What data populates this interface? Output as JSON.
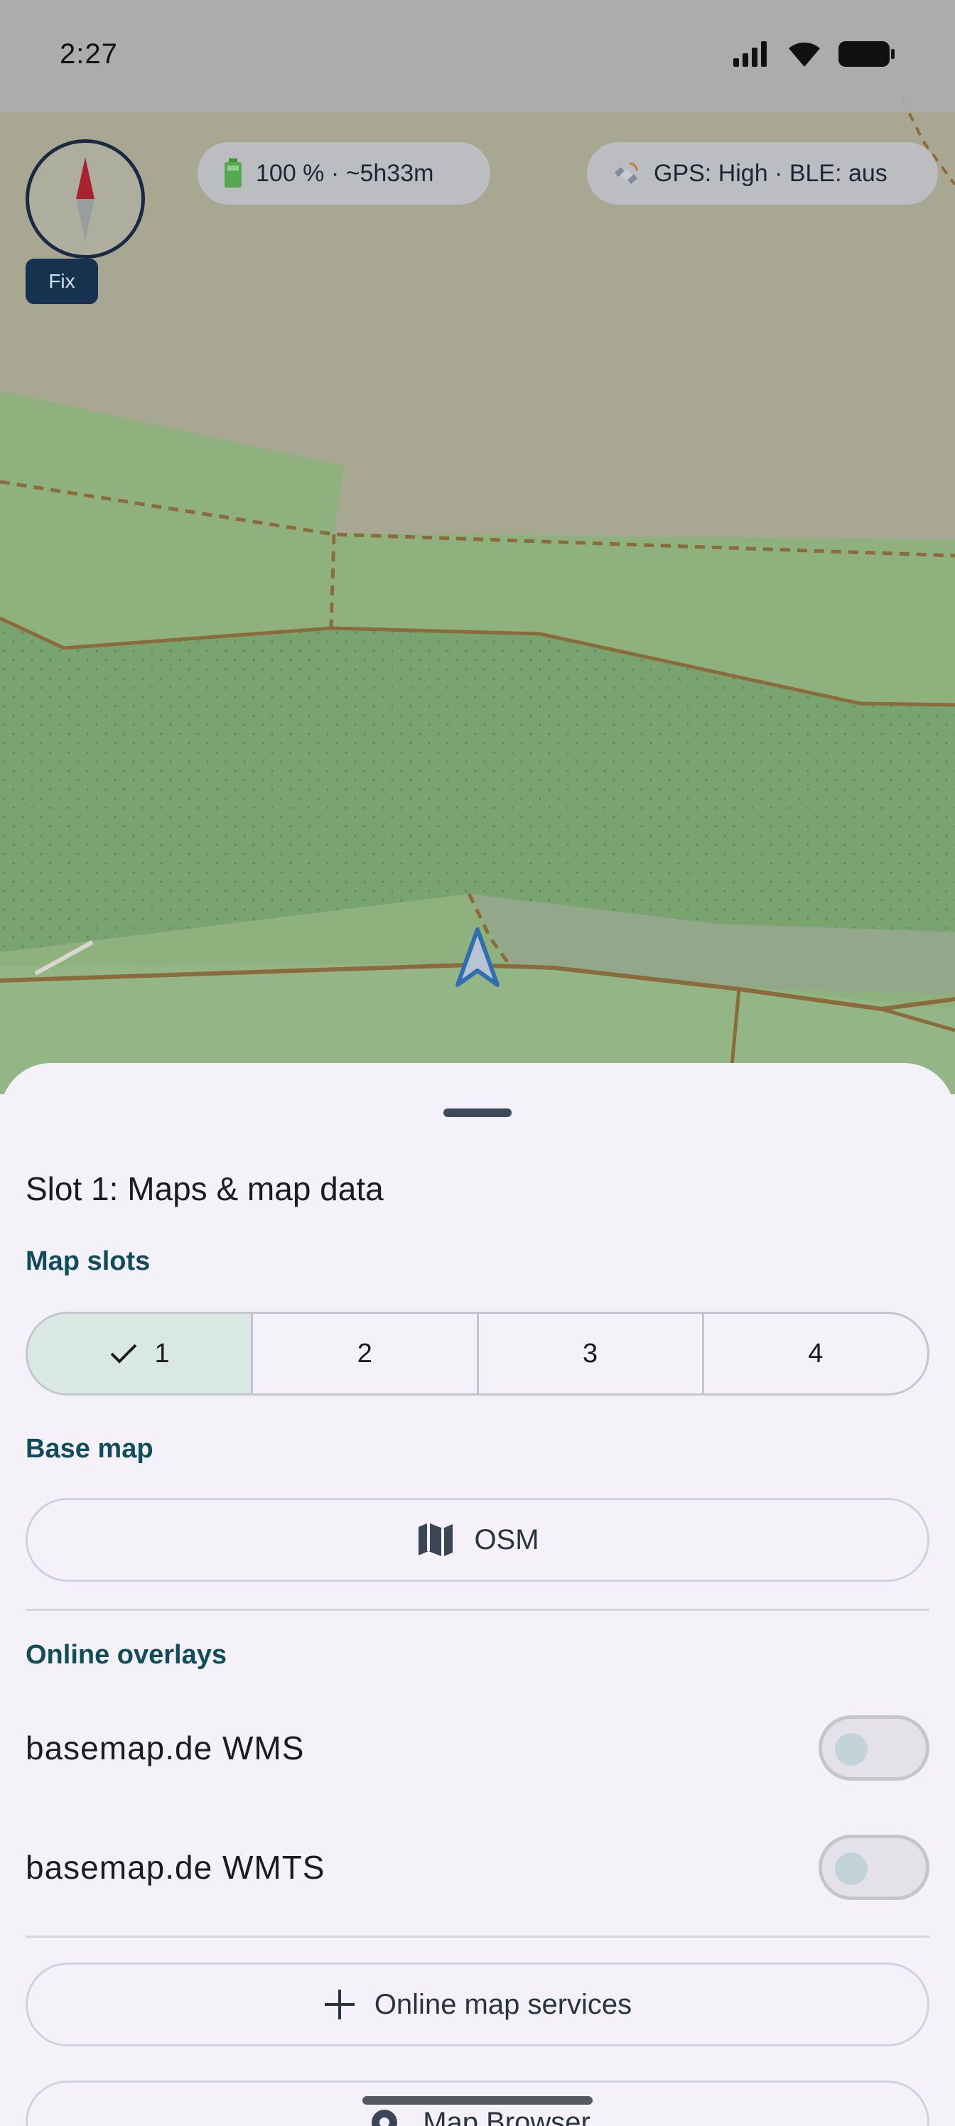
{
  "status_bar": {
    "time": "2:27"
  },
  "map": {
    "battery_text": "100 % · ~5h33m",
    "gps_text": "GPS: High · BLE: aus",
    "fix_label": "Fix"
  },
  "sheet": {
    "title": "Slot 1: Maps & map data",
    "map_slots_label": "Map slots",
    "slots": [
      "1",
      "2",
      "3",
      "4"
    ],
    "selected_slot": "1",
    "base_map_label": "Base map",
    "base_map_value": "OSM",
    "online_overlays_label": "Online overlays",
    "overlays": [
      {
        "name": "basemap.de WMS",
        "enabled": false
      },
      {
        "name": "basemap.de WMTS",
        "enabled": false
      }
    ],
    "online_services_label": "Online map services",
    "map_browser_label": "Map Browser"
  }
}
